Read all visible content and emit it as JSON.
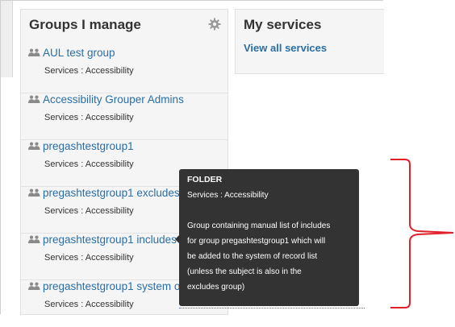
{
  "groups_panel": {
    "title": "Groups I manage",
    "items": [
      {
        "name": "AUL test group",
        "sub": "Services : Accessibility"
      },
      {
        "name": "Accessibility Grouper Admins",
        "sub": "Services : Accessibility"
      },
      {
        "name": "pregashtestgroup1",
        "sub": "Services : Accessibility"
      },
      {
        "name": "pregashtestgroup1 excludes",
        "sub": "Services : Accessibility"
      },
      {
        "name": "pregashtestgroup1 includes",
        "sub": "Services : Accessibility"
      },
      {
        "name": "pregashtestgroup1 system of record",
        "sub": "Services : Accessibility"
      }
    ]
  },
  "services_panel": {
    "title": "My services",
    "link": "View all services"
  },
  "tooltip": {
    "title": "FOLDER",
    "path": "Services : Accessibility",
    "lines": [
      "Group containing manual list of includes",
      "for group pregashtestgroup1 which will",
      "be added to the system of record list",
      "(unless the subject is also in the",
      "excludes group)"
    ]
  },
  "colors": {
    "link": "#2a6ea6",
    "panel_bg": "#f5f5f5",
    "tooltip_bg": "#333333",
    "annotation": "#e0202a"
  },
  "icons": {
    "settings": "gear-icon",
    "group": "group-icon"
  }
}
